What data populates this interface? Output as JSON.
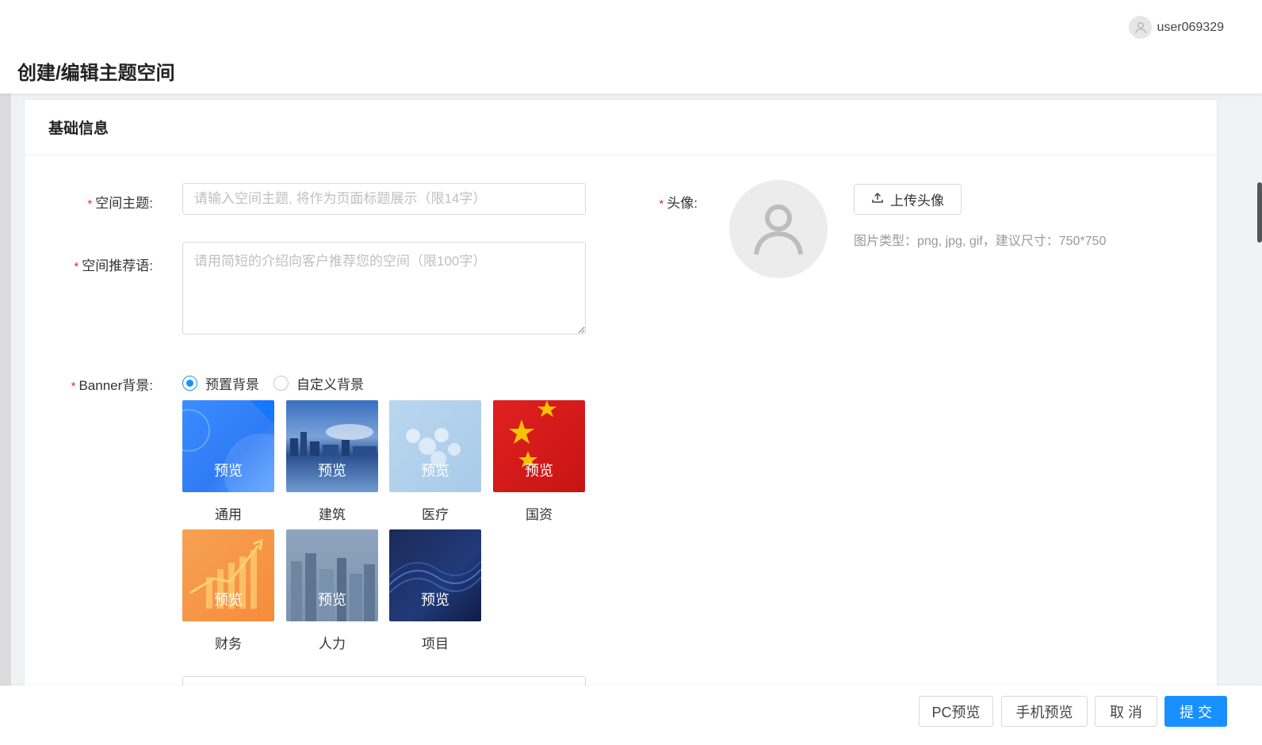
{
  "header": {
    "username": "user069329",
    "page_title": "创建/编辑主题空间"
  },
  "section": {
    "title": "基础信息"
  },
  "form": {
    "required_mark": "*",
    "theme_label": "空间主题:",
    "theme_placeholder": "请输入空间主题, 将作为页面标题展示（限14字）",
    "theme_value": "",
    "intro_label": "空间推荐语:",
    "intro_placeholder": "请用简短的介绍向客户推荐您的空间（限100字）",
    "banner_label": "Banner背景:",
    "banner_options": [
      "预置背景",
      "自定义背景"
    ],
    "banner_selected": "预置背景",
    "preview_label": "预览",
    "presets": [
      "通用",
      "建筑",
      "医疗",
      "国资",
      "财务",
      "人力",
      "项目"
    ],
    "avatar_label": "头像:",
    "upload_label": "上传头像",
    "upload_hint": "图片类型：png, jpg, gif，建议尺寸：750*750"
  },
  "footer": {
    "pc_preview": "PC预览",
    "mobile_preview": "手机预览",
    "cancel": "取 消",
    "submit": "提 交"
  },
  "colors": {
    "primary": "#1890ff",
    "required": "#f5222d"
  },
  "icons": {
    "user_avatar": "user-icon",
    "upload": "upload-icon",
    "selected_check": "check-icon"
  }
}
